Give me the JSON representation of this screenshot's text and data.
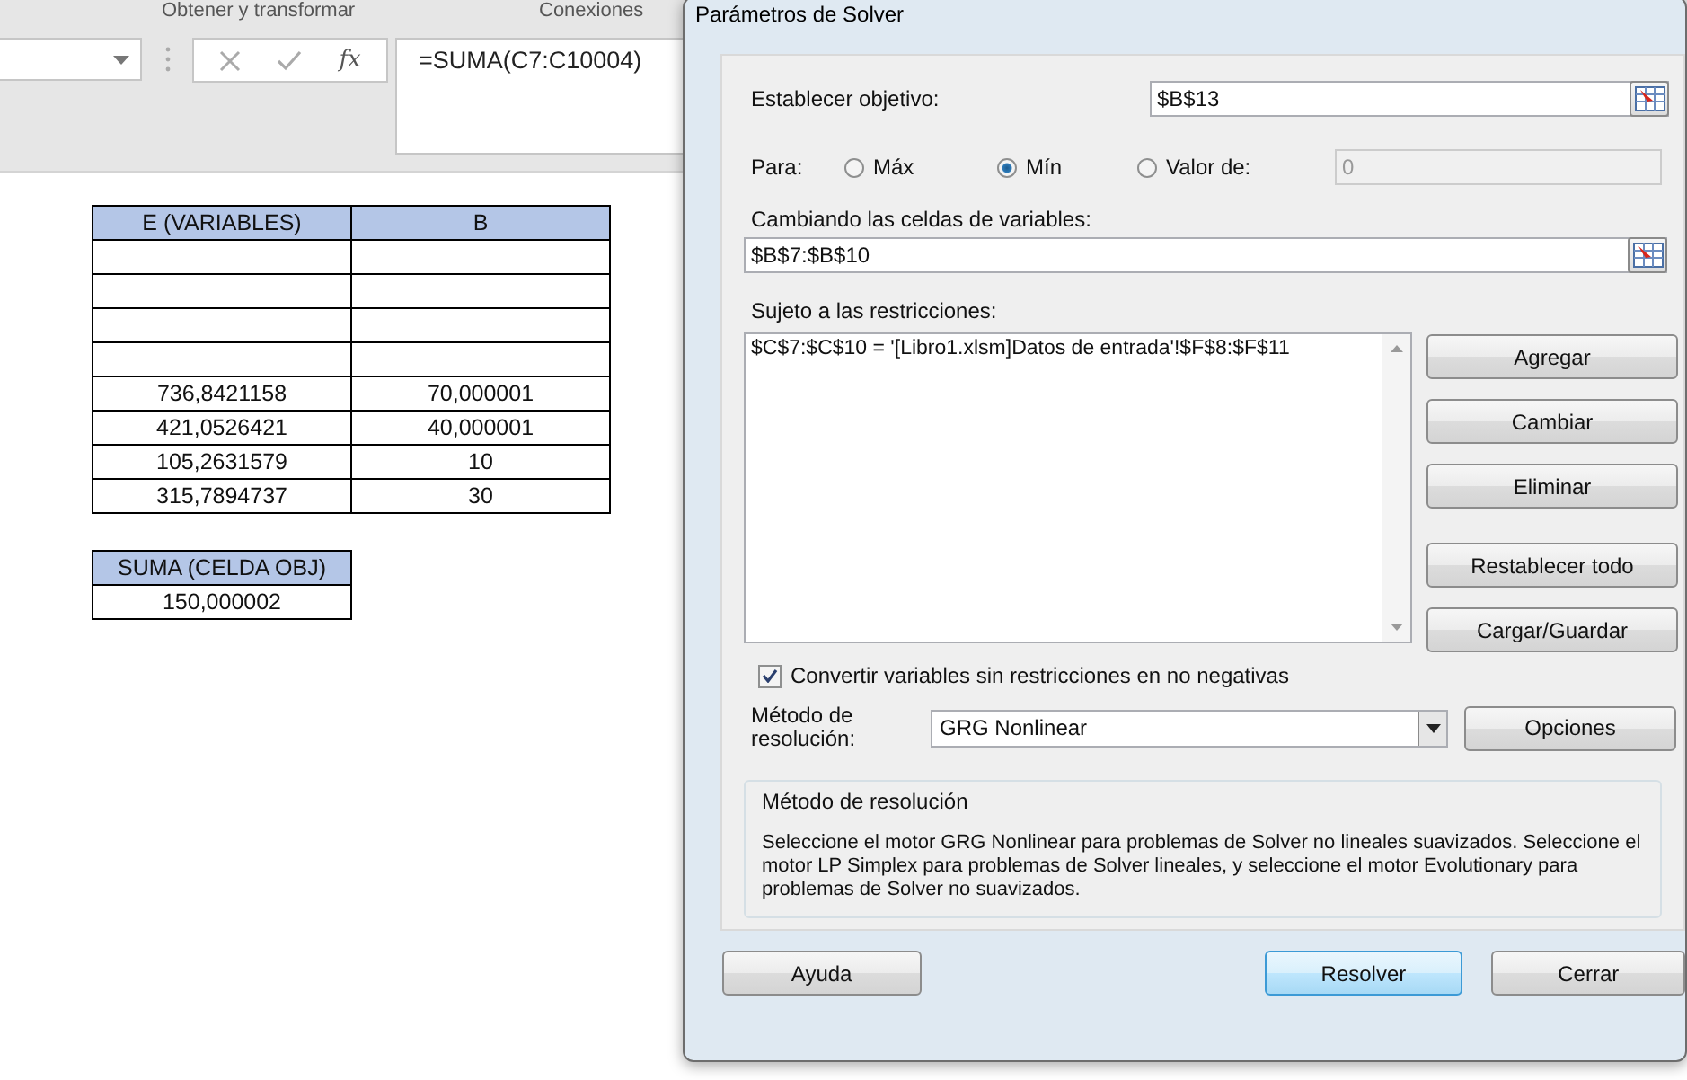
{
  "ribbon": {
    "group_labels": [
      "Obtener y transformar",
      "Conexiones"
    ]
  },
  "formula_bar": {
    "fx": "fx",
    "formula": "=SUMA(C7:C10004)"
  },
  "sheet": {
    "variables_table": {
      "columns": [
        "E (VARIABLES)",
        "B"
      ],
      "rows": [
        [
          "",
          ""
        ],
        [
          "",
          ""
        ],
        [
          "",
          ""
        ],
        [
          "",
          ""
        ],
        [
          "736,8421158",
          "70,000001"
        ],
        [
          "421,0526421",
          "40,000001"
        ],
        [
          "105,2631579",
          "10"
        ],
        [
          "315,7894737",
          "30"
        ]
      ]
    },
    "objective_table": {
      "columns": [
        "SUMA (CELDA OBJ)"
      ],
      "rows": [
        [
          "150,000002"
        ]
      ]
    }
  },
  "dialog": {
    "title": "Parámetros de Solver",
    "objective": {
      "label": "Establecer objetivo:",
      "value": "$B$13"
    },
    "para": {
      "label": "Para:",
      "options": [
        {
          "label": "Máx",
          "selected": false
        },
        {
          "label": "Mín",
          "selected": true
        },
        {
          "label": "Valor de:",
          "selected": false
        }
      ],
      "value_field": {
        "value": "0",
        "disabled": true
      }
    },
    "changing": {
      "label": "Cambiando las celdas de variables:",
      "value": "$B$7:$B$10"
    },
    "constraints": {
      "label": "Sujeto a las restricciones:",
      "items": [
        "$C$7:$C$10 = '[Libro1.xlsm]Datos de entrada'!$F$8:$F$11"
      ]
    },
    "side_buttons": [
      "Agregar",
      "Cambiar",
      "Eliminar",
      "Restablecer todo",
      "Cargar/Guardar"
    ],
    "nonnegative": {
      "label": "Convertir variables sin restricciones en no negativas",
      "checked": true
    },
    "method": {
      "label": "Método de resolución:",
      "value": "GRG Nonlinear",
      "options_button": "Opciones"
    },
    "description": {
      "title": "Método de resolución",
      "text": "Seleccione el motor GRG Nonlinear para problemas de Solver no lineales suavizados. Seleccione el motor LP Simplex para problemas de Solver lineales, y seleccione el motor Evolutionary para problemas de Solver no suavizados."
    },
    "footer_buttons": [
      {
        "label": "Ayuda",
        "default": false
      },
      {
        "label": "Resolver",
        "default": true
      },
      {
        "label": "Cerrar",
        "default": false
      }
    ]
  }
}
